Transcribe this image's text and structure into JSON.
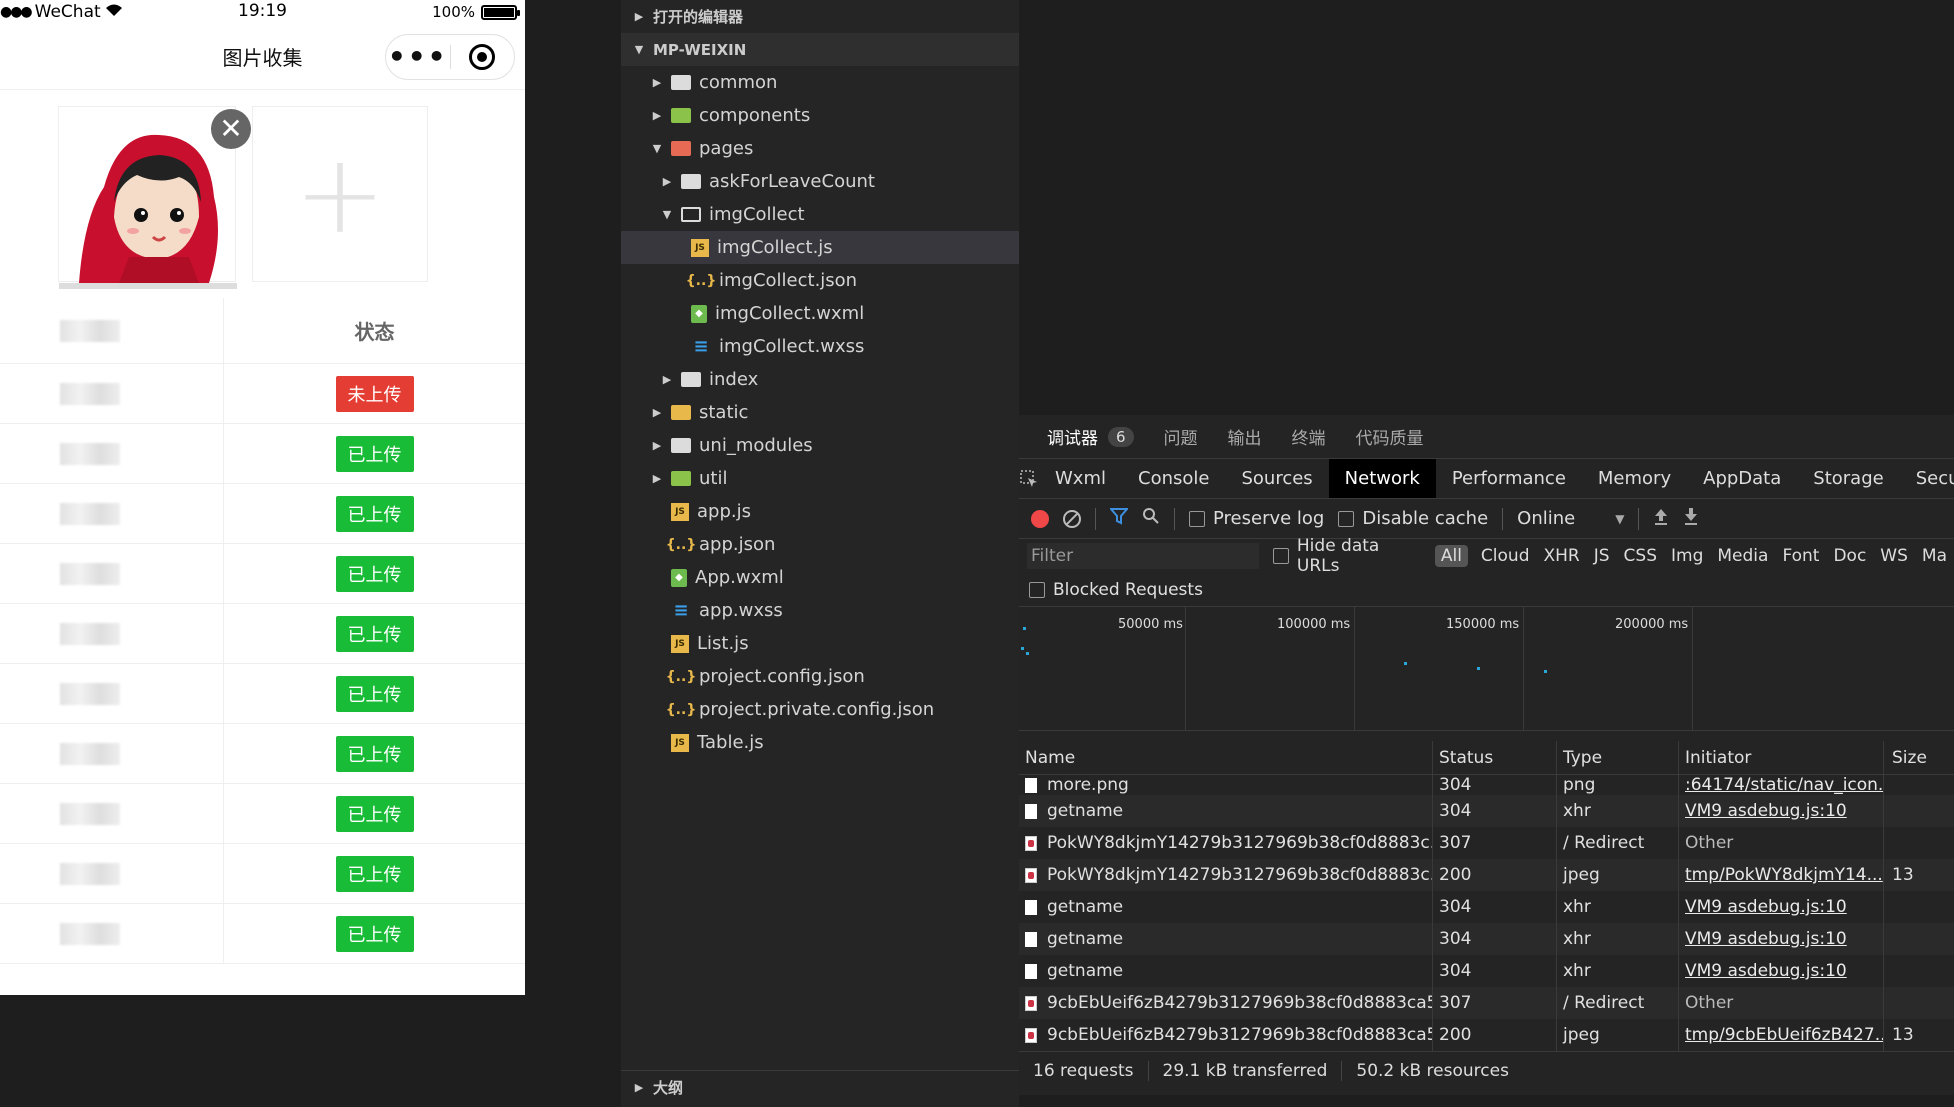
{
  "phone": {
    "status_bar": {
      "carrier": "WeChat",
      "time": "19:19",
      "battery": "100%"
    },
    "nav": {
      "title": "图片收集",
      "more": "•••"
    },
    "image_remove": "✕",
    "add_symbol": "+",
    "table": {
      "header_status": "状态",
      "rows": [
        {
          "status": "未上传",
          "color": "#e43d33"
        },
        {
          "status": "已上传",
          "color": "#18bc37"
        },
        {
          "status": "已上传",
          "color": "#18bc37"
        },
        {
          "status": "已上传",
          "color": "#18bc37"
        },
        {
          "status": "已上传",
          "color": "#18bc37"
        },
        {
          "status": "已上传",
          "color": "#18bc37"
        },
        {
          "status": "已上传",
          "color": "#18bc37"
        },
        {
          "status": "已上传",
          "color": "#18bc37"
        },
        {
          "status": "已上传",
          "color": "#18bc37"
        },
        {
          "status": "已上传",
          "color": "#18bc37"
        }
      ]
    }
  },
  "explorer": {
    "open_editors": "打开的编辑器",
    "project": "MP-WEIXIN",
    "outline": "大纲",
    "tree": [
      {
        "label": "common",
        "icon": "folder"
      },
      {
        "label": "components",
        "icon": "folder-green"
      },
      {
        "label": "pages",
        "icon": "folder-red"
      },
      {
        "label": "askForLeaveCount",
        "icon": "folder"
      },
      {
        "label": "imgCollect",
        "icon": "folder-open"
      },
      {
        "label": "imgCollect.js",
        "icon": "js"
      },
      {
        "label": "imgCollect.json",
        "icon": "json"
      },
      {
        "label": "imgCollect.wxml",
        "icon": "wxml"
      },
      {
        "label": "imgCollect.wxss",
        "icon": "wxss"
      },
      {
        "label": "index",
        "icon": "folder"
      },
      {
        "label": "static",
        "icon": "folder-yellow"
      },
      {
        "label": "uni_modules",
        "icon": "folder"
      },
      {
        "label": "util",
        "icon": "folder-green"
      },
      {
        "label": "app.js",
        "icon": "js"
      },
      {
        "label": "app.json",
        "icon": "json"
      },
      {
        "label": "App.wxml",
        "icon": "wxml"
      },
      {
        "label": "app.wxss",
        "icon": "wxss"
      },
      {
        "label": "List.js",
        "icon": "js"
      },
      {
        "label": "project.config.json",
        "icon": "json"
      },
      {
        "label": "project.private.config.json",
        "icon": "json"
      },
      {
        "label": "Table.js",
        "icon": "js"
      }
    ]
  },
  "devtools": {
    "top_tabs": {
      "debugger": "调试器",
      "debugger_count": "6",
      "issues": "问题",
      "output": "输出",
      "terminal": "终端",
      "code_quality": "代码质量"
    },
    "tabs": [
      "Wxml",
      "Console",
      "Sources",
      "Network",
      "Performance",
      "Memory",
      "AppData",
      "Storage",
      "Secu"
    ],
    "toolbar": {
      "preserve_log": "Preserve log",
      "disable_cache": "Disable cache",
      "throttle": "Online",
      "dropdown": "▼"
    },
    "filter": {
      "placeholder": "Filter",
      "hide_data_urls": "Hide data URLs",
      "types": [
        "All",
        "Cloud",
        "XHR",
        "JS",
        "CSS",
        "Img",
        "Media",
        "Font",
        "Doc",
        "WS",
        "Ma"
      ],
      "blocked_requests": "Blocked Requests"
    },
    "timeline_ticks": [
      "50000 ms",
      "100000 ms",
      "150000 ms",
      "200000 ms"
    ],
    "columns": {
      "name": "Name",
      "status": "Status",
      "type": "Type",
      "initiator": "Initiator",
      "size": "Size"
    },
    "rows": [
      {
        "name": "more.png",
        "status": "304",
        "type": "png",
        "initiator": ":64174/static/nav_icon...",
        "size": "",
        "icon": "file",
        "initiator_link": true
      },
      {
        "name": "getname",
        "status": "304",
        "type": "xhr",
        "initiator": "VM9 asdebug.js:10",
        "size": "",
        "icon": "file",
        "initiator_link": true
      },
      {
        "name": "PokWY8dkjmY14279b3127969b38cf0d8883c...",
        "status": "307",
        "type": "/ Redirect",
        "initiator": "Other",
        "size": "",
        "icon": "image",
        "initiator_link": false
      },
      {
        "name": "PokWY8dkjmY14279b3127969b38cf0d8883c...",
        "status": "200",
        "type": "jpeg",
        "initiator": "tmp/PokWY8dkjmY14...",
        "size": "13",
        "icon": "image",
        "initiator_link": true
      },
      {
        "name": "getname",
        "status": "304",
        "type": "xhr",
        "initiator": "VM9 asdebug.js:10",
        "size": "",
        "icon": "file",
        "initiator_link": true
      },
      {
        "name": "getname",
        "status": "304",
        "type": "xhr",
        "initiator": "VM9 asdebug.js:10",
        "size": "",
        "icon": "file",
        "initiator_link": true
      },
      {
        "name": "getname",
        "status": "304",
        "type": "xhr",
        "initiator": "VM9 asdebug.js:10",
        "size": "",
        "icon": "file",
        "initiator_link": true
      },
      {
        "name": "9cbEbUeif6zB4279b3127969b38cf0d8883ca5...",
        "status": "307",
        "type": "/ Redirect",
        "initiator": "Other",
        "size": "",
        "icon": "image",
        "initiator_link": false
      },
      {
        "name": "9cbEbUeif6zB4279b3127969b38cf0d8883ca5...",
        "status": "200",
        "type": "jpeg",
        "initiator": "tmp/9cbEbUeif6zB427...",
        "size": "13",
        "icon": "image",
        "initiator_link": true
      }
    ],
    "footer": {
      "requests": "16 requests",
      "transferred": "29.1 kB transferred",
      "resources": "50.2 kB resources"
    }
  }
}
